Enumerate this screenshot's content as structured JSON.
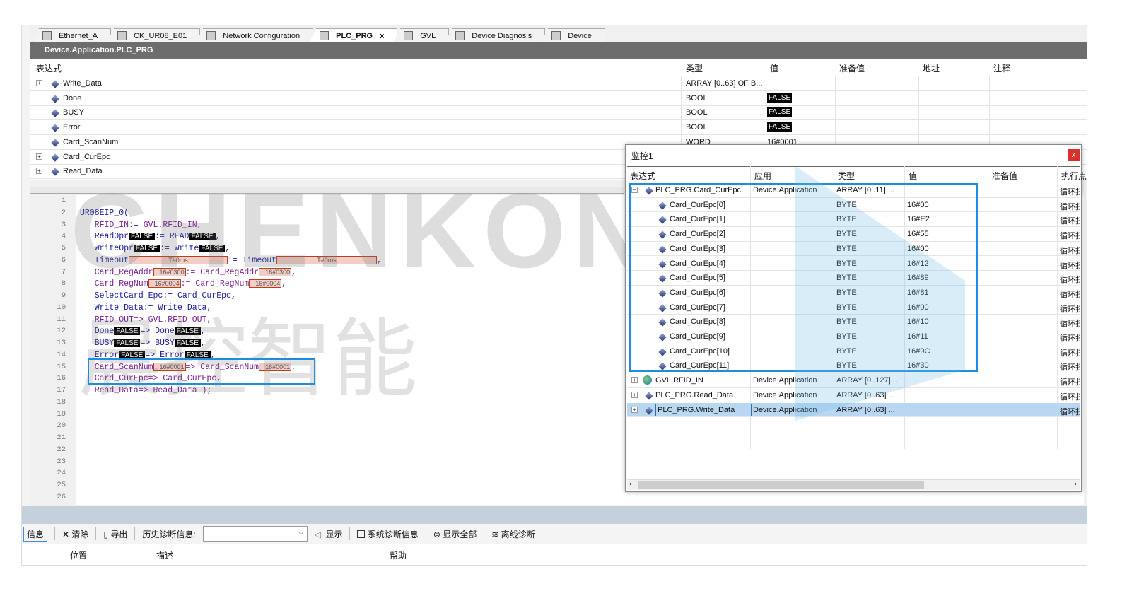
{
  "tabs": [
    {
      "label": "Ethernet_A",
      "icon": "device-icon"
    },
    {
      "label": "CK_UR08_E01",
      "icon": "ck-module-icon"
    },
    {
      "label": "Network Configuration",
      "icon": "network-config-icon"
    },
    {
      "label": "PLC_PRG",
      "icon": "program-icon",
      "active": true,
      "close": "x"
    },
    {
      "label": "GVL",
      "icon": "globe-icon"
    },
    {
      "label": "Device Diagnosis",
      "icon": "magnifier-icon"
    },
    {
      "label": "Device",
      "icon": "device-icon"
    }
  ],
  "path": "Device.Application.PLC_PRG",
  "var_table": {
    "headers": [
      "表达式",
      "类型",
      "值",
      "准备值",
      "地址",
      "注释"
    ],
    "rows": [
      {
        "name": "Write_Data",
        "type": "ARRAY [0..63] OF B...",
        "value": "",
        "expand": true
      },
      {
        "name": "Done",
        "type": "BOOL",
        "value": "FALSE"
      },
      {
        "name": "BUSY",
        "type": "BOOL",
        "value": "FALSE"
      },
      {
        "name": "Error",
        "type": "BOOL",
        "value": "FALSE"
      },
      {
        "name": "Card_ScanNum",
        "type": "WORD",
        "value": "16#0001"
      },
      {
        "name": "Card_CurEpc",
        "type": "",
        "value": "",
        "expand": true
      },
      {
        "name": "Read_Data",
        "type": "",
        "value": "",
        "expand": true
      }
    ]
  },
  "code": [
    [],
    [
      {
        "t": "UR08EIP_0(",
        "c": "b"
      }
    ],
    [
      {
        "t": "   RFID_IN",
        "c": "p"
      },
      {
        "t": ":= ",
        "c": "o"
      },
      {
        "t": "GVL.RFID_IN",
        "c": "p"
      },
      {
        "t": ",",
        "c": "o"
      }
    ],
    [
      {
        "t": "   ReadOpr",
        "c": "b"
      },
      {
        "t": "FALSE",
        "c": "f"
      },
      {
        "t": ":= READ",
        "c": "b"
      },
      {
        "t": "FALSE",
        "c": "f"
      },
      {
        "t": ",",
        "c": "o"
      }
    ],
    [
      {
        "t": "   WriteOpr",
        "c": "b"
      },
      {
        "t": "FALSE",
        "c": "f"
      },
      {
        "t": ":= Write",
        "c": "b"
      },
      {
        "t": "FALSE",
        "c": "f"
      },
      {
        "t": ",",
        "c": "o"
      }
    ],
    [
      {
        "t": "   Timeout",
        "c": "b"
      },
      {
        "t": "T#0ms",
        "c": "v",
        "w": 140
      },
      {
        "t": ":= Timeout",
        "c": "b"
      },
      {
        "t": "T#0ms",
        "c": "v",
        "w": 142
      },
      {
        "t": ",",
        "c": "o"
      }
    ],
    [
      {
        "t": "   Card_RegAddr",
        "c": "p"
      },
      {
        "t": "16#0300",
        "c": "v",
        "w": 46
      },
      {
        "t": ":= Card_RegAddr",
        "c": "p"
      },
      {
        "t": "16#0300",
        "c": "v",
        "w": 46
      },
      {
        "t": ",",
        "c": "o"
      }
    ],
    [
      {
        "t": "   Card_RegNum",
        "c": "p"
      },
      {
        "t": "16#0004",
        "c": "v",
        "w": 46
      },
      {
        "t": ":= Card_RegNum",
        "c": "p"
      },
      {
        "t": "16#0004",
        "c": "v",
        "w": 46
      },
      {
        "t": ",",
        "c": "o"
      }
    ],
    [
      {
        "t": "   SelectCard_Epc:= Card_CurEpc,",
        "c": "b"
      }
    ],
    [
      {
        "t": "   Write_Data:= Write_Data,",
        "c": "b"
      }
    ],
    [
      {
        "t": "   RFID_OUT",
        "c": "p"
      },
      {
        "t": "=> GVL.RFID_OUT,",
        "c": "p"
      }
    ],
    [
      {
        "t": "   Done",
        "c": "b"
      },
      {
        "t": "FALSE",
        "c": "f"
      },
      {
        "t": "=> Done",
        "c": "b"
      },
      {
        "t": "FALSE",
        "c": "f"
      },
      {
        "t": ",",
        "c": "o"
      }
    ],
    [
      {
        "t": "   BUSY",
        "c": "b"
      },
      {
        "t": "FALSE",
        "c": "f"
      },
      {
        "t": "=> BUSY",
        "c": "b"
      },
      {
        "t": "FALSE",
        "c": "f"
      },
      {
        "t": ",",
        "c": "o"
      }
    ],
    [
      {
        "t": "   Error",
        "c": "b"
      },
      {
        "t": "FALSE",
        "c": "f"
      },
      {
        "t": "=> Error",
        "c": "b"
      },
      {
        "t": "FALSE",
        "c": "f"
      },
      {
        "t": ",",
        "c": "o"
      }
    ],
    [
      {
        "t": "   Card_ScanNum",
        "c": "p"
      },
      {
        "t": "16#0001",
        "c": "v",
        "w": 46
      },
      {
        "t": "=> Card_ScanNum",
        "c": "p"
      },
      {
        "t": "16#0001",
        "c": "v",
        "w": 46
      },
      {
        "t": ",",
        "c": "o"
      }
    ],
    [
      {
        "t": "   Card_CurEpc=> Card_CurEpc,",
        "c": "p"
      }
    ],
    [
      {
        "t": "   Read_Data=> Read_Data );",
        "c": "p"
      }
    ],
    [],
    [],
    [],
    [],
    [],
    [],
    [],
    [],
    []
  ],
  "monitor": {
    "title": "监控1",
    "close": "x",
    "headers": [
      "表达式",
      "应用",
      "类型",
      "值",
      "准备值",
      "执行点"
    ],
    "rows": [
      {
        "expr": "PLC_PRG.Card_CurEpc",
        "app": "Device.Application",
        "type": "ARRAY [0..11] ...",
        "value": "",
        "exec": "循环扫",
        "expand": "−",
        "level": 0
      },
      {
        "expr": "Card_CurEpc[0]",
        "app": "",
        "type": "BYTE",
        "value": "16#00",
        "exec": "循环扫",
        "level": 1
      },
      {
        "expr": "Card_CurEpc[1]",
        "app": "",
        "type": "BYTE",
        "value": "16#E2",
        "exec": "循环扫",
        "level": 1
      },
      {
        "expr": "Card_CurEpc[2]",
        "app": "",
        "type": "BYTE",
        "value": "16#55",
        "exec": "循环扫",
        "level": 1
      },
      {
        "expr": "Card_CurEpc[3]",
        "app": "",
        "type": "BYTE",
        "value": "16#00",
        "exec": "循环扫",
        "level": 1
      },
      {
        "expr": "Card_CurEpc[4]",
        "app": "",
        "type": "BYTE",
        "value": "16#12",
        "exec": "循环扫",
        "level": 1
      },
      {
        "expr": "Card_CurEpc[5]",
        "app": "",
        "type": "BYTE",
        "value": "16#89",
        "exec": "循环扫",
        "level": 1
      },
      {
        "expr": "Card_CurEpc[6]",
        "app": "",
        "type": "BYTE",
        "value": "16#81",
        "exec": "循环扫",
        "level": 1
      },
      {
        "expr": "Card_CurEpc[7]",
        "app": "",
        "type": "BYTE",
        "value": "16#00",
        "exec": "循环扫",
        "level": 1
      },
      {
        "expr": "Card_CurEpc[8]",
        "app": "",
        "type": "BYTE",
        "value": "16#10",
        "exec": "循环扫",
        "level": 1
      },
      {
        "expr": "Card_CurEpc[9]",
        "app": "",
        "type": "BYTE",
        "value": "16#11",
        "exec": "循环扫",
        "level": 1
      },
      {
        "expr": "Card_CurEpc[10]",
        "app": "",
        "type": "BYTE",
        "value": "16#9C",
        "exec": "循环扫",
        "level": 1
      },
      {
        "expr": "Card_CurEpc[11]",
        "app": "",
        "type": "BYTE",
        "value": "16#30",
        "exec": "循环扫",
        "level": 1
      },
      {
        "expr": "GVL.RFID_IN",
        "app": "Device.Application",
        "type": "ARRAY [0..127]...",
        "value": "",
        "exec": "循环扫",
        "expand": "+",
        "level": 0,
        "globe": true
      },
      {
        "expr": "PLC_PRG.Read_Data",
        "app": "Device.Application",
        "type": "ARRAY [0..63] ...",
        "value": "",
        "exec": "循环扫",
        "expand": "+",
        "level": 0
      },
      {
        "expr": "PLC_PRG.Write_Data",
        "app": "Device.Application",
        "type": "ARRAY [0..63] ...",
        "value": "",
        "exec": "循环扫",
        "expand": "+",
        "level": 0,
        "selected": true
      }
    ]
  },
  "toolbar": {
    "info": "信息",
    "clear": "清除",
    "export": "导出",
    "history_label": "历史诊断信息:",
    "history_value": "",
    "show": "显示",
    "sys_diag": "系统诊断信息",
    "show_all": "显示全部",
    "offline_diag": "离线诊断"
  },
  "msg_headers": [
    "位置",
    "描述",
    "帮助"
  ],
  "watermark": {
    "text": "CHENKONG",
    "cn": "晨控智能",
    "mark": "®"
  }
}
